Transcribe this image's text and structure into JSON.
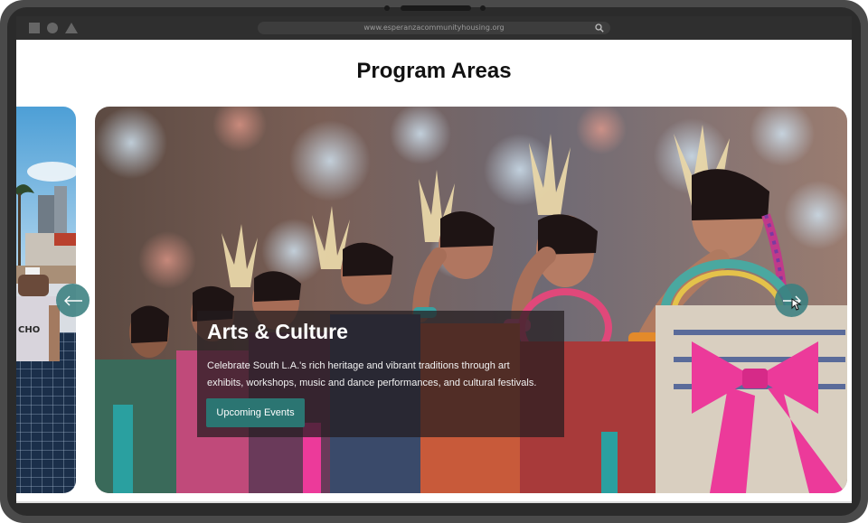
{
  "browser": {
    "url": "www.esperanzacommunityhousing.org",
    "window_controls": [
      "square-icon",
      "circle-icon",
      "triangle-icon"
    ]
  },
  "page": {
    "title": "Program Areas"
  },
  "carousel": {
    "active_slide": {
      "title": "Arts & Culture",
      "description": "Celebrate South L.A.'s rich heritage and vibrant traditions through art exhibits, workshops, music and dance performances, and cultural festivals.",
      "button_label": "Upcoming Events"
    },
    "prev_arrow_icon": "arrow-left-icon",
    "next_arrow_icon": "arrow-right-icon"
  },
  "colors": {
    "accent": "#2b7572",
    "arrow": "#3a8080",
    "caption_overlay": "#231c1e"
  }
}
